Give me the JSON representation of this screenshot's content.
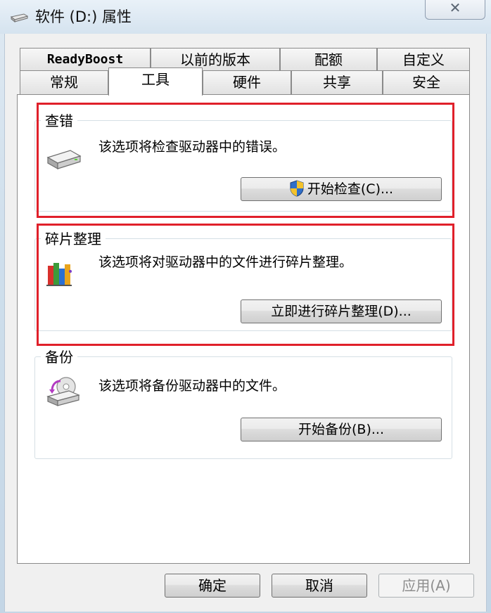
{
  "window": {
    "title": "软件 (D:) 属性",
    "close_glyph": "✕"
  },
  "tabs": {
    "row1": [
      "ReadyBoost",
      "以前的版本",
      "配额",
      "自定义"
    ],
    "row2": [
      "常规",
      "工具",
      "硬件",
      "共享",
      "安全"
    ],
    "active": "工具"
  },
  "groups": {
    "check": {
      "label": "查错",
      "description": "该选项将检查驱动器中的错误。",
      "button": "开始检查(C)..."
    },
    "defrag": {
      "label": "碎片整理",
      "description": "该选项将对驱动器中的文件进行碎片整理。",
      "button": "立即进行碎片整理(D)..."
    },
    "backup": {
      "label": "备份",
      "description": "该选项将备份驱动器中的文件。",
      "button": "开始备份(B)..."
    }
  },
  "footer": {
    "ok": "确定",
    "cancel": "取消",
    "apply": "应用(A)"
  },
  "colors": {
    "highlight": "#e0202a",
    "panel_bg": "#ffffff",
    "dialog_bg": "#f0f0f0"
  }
}
